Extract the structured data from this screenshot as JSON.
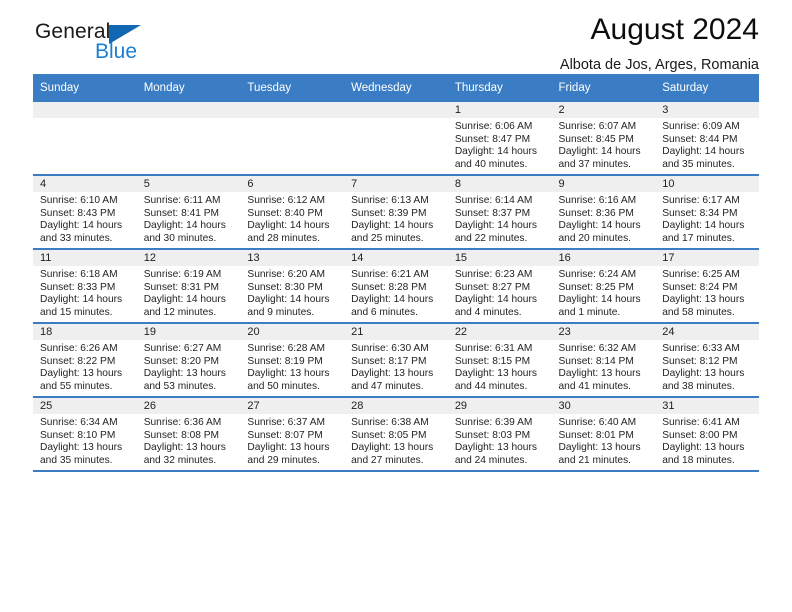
{
  "brand": {
    "name_part1": "General",
    "name_part2": "Blue",
    "logo_icon": "triangle-logo-icon"
  },
  "header": {
    "month_title": "August 2024",
    "location": "Albota de Jos, Arges, Romania"
  },
  "calendar": {
    "weekday_headers": [
      "Sunday",
      "Monday",
      "Tuesday",
      "Wednesday",
      "Thursday",
      "Friday",
      "Saturday"
    ],
    "accent_color": "#3b7dc4",
    "daynum_band_color": "#efefef",
    "weeks": [
      [
        {
          "day": "",
          "empty": true
        },
        {
          "day": "",
          "empty": true
        },
        {
          "day": "",
          "empty": true
        },
        {
          "day": "",
          "empty": true
        },
        {
          "day": "1",
          "sunrise": "Sunrise: 6:06 AM",
          "sunset": "Sunset: 8:47 PM",
          "daylight": "Daylight: 14 hours and 40 minutes."
        },
        {
          "day": "2",
          "sunrise": "Sunrise: 6:07 AM",
          "sunset": "Sunset: 8:45 PM",
          "daylight": "Daylight: 14 hours and 37 minutes."
        },
        {
          "day": "3",
          "sunrise": "Sunrise: 6:09 AM",
          "sunset": "Sunset: 8:44 PM",
          "daylight": "Daylight: 14 hours and 35 minutes."
        }
      ],
      [
        {
          "day": "4",
          "sunrise": "Sunrise: 6:10 AM",
          "sunset": "Sunset: 8:43 PM",
          "daylight": "Daylight: 14 hours and 33 minutes."
        },
        {
          "day": "5",
          "sunrise": "Sunrise: 6:11 AM",
          "sunset": "Sunset: 8:41 PM",
          "daylight": "Daylight: 14 hours and 30 minutes."
        },
        {
          "day": "6",
          "sunrise": "Sunrise: 6:12 AM",
          "sunset": "Sunset: 8:40 PM",
          "daylight": "Daylight: 14 hours and 28 minutes."
        },
        {
          "day": "7",
          "sunrise": "Sunrise: 6:13 AM",
          "sunset": "Sunset: 8:39 PM",
          "daylight": "Daylight: 14 hours and 25 minutes."
        },
        {
          "day": "8",
          "sunrise": "Sunrise: 6:14 AM",
          "sunset": "Sunset: 8:37 PM",
          "daylight": "Daylight: 14 hours and 22 minutes."
        },
        {
          "day": "9",
          "sunrise": "Sunrise: 6:16 AM",
          "sunset": "Sunset: 8:36 PM",
          "daylight": "Daylight: 14 hours and 20 minutes."
        },
        {
          "day": "10",
          "sunrise": "Sunrise: 6:17 AM",
          "sunset": "Sunset: 8:34 PM",
          "daylight": "Daylight: 14 hours and 17 minutes."
        }
      ],
      [
        {
          "day": "11",
          "sunrise": "Sunrise: 6:18 AM",
          "sunset": "Sunset: 8:33 PM",
          "daylight": "Daylight: 14 hours and 15 minutes."
        },
        {
          "day": "12",
          "sunrise": "Sunrise: 6:19 AM",
          "sunset": "Sunset: 8:31 PM",
          "daylight": "Daylight: 14 hours and 12 minutes."
        },
        {
          "day": "13",
          "sunrise": "Sunrise: 6:20 AM",
          "sunset": "Sunset: 8:30 PM",
          "daylight": "Daylight: 14 hours and 9 minutes."
        },
        {
          "day": "14",
          "sunrise": "Sunrise: 6:21 AM",
          "sunset": "Sunset: 8:28 PM",
          "daylight": "Daylight: 14 hours and 6 minutes."
        },
        {
          "day": "15",
          "sunrise": "Sunrise: 6:23 AM",
          "sunset": "Sunset: 8:27 PM",
          "daylight": "Daylight: 14 hours and 4 minutes."
        },
        {
          "day": "16",
          "sunrise": "Sunrise: 6:24 AM",
          "sunset": "Sunset: 8:25 PM",
          "daylight": "Daylight: 14 hours and 1 minute."
        },
        {
          "day": "17",
          "sunrise": "Sunrise: 6:25 AM",
          "sunset": "Sunset: 8:24 PM",
          "daylight": "Daylight: 13 hours and 58 minutes."
        }
      ],
      [
        {
          "day": "18",
          "sunrise": "Sunrise: 6:26 AM",
          "sunset": "Sunset: 8:22 PM",
          "daylight": "Daylight: 13 hours and 55 minutes."
        },
        {
          "day": "19",
          "sunrise": "Sunrise: 6:27 AM",
          "sunset": "Sunset: 8:20 PM",
          "daylight": "Daylight: 13 hours and 53 minutes."
        },
        {
          "day": "20",
          "sunrise": "Sunrise: 6:28 AM",
          "sunset": "Sunset: 8:19 PM",
          "daylight": "Daylight: 13 hours and 50 minutes."
        },
        {
          "day": "21",
          "sunrise": "Sunrise: 6:30 AM",
          "sunset": "Sunset: 8:17 PM",
          "daylight": "Daylight: 13 hours and 47 minutes."
        },
        {
          "day": "22",
          "sunrise": "Sunrise: 6:31 AM",
          "sunset": "Sunset: 8:15 PM",
          "daylight": "Daylight: 13 hours and 44 minutes."
        },
        {
          "day": "23",
          "sunrise": "Sunrise: 6:32 AM",
          "sunset": "Sunset: 8:14 PM",
          "daylight": "Daylight: 13 hours and 41 minutes."
        },
        {
          "day": "24",
          "sunrise": "Sunrise: 6:33 AM",
          "sunset": "Sunset: 8:12 PM",
          "daylight": "Daylight: 13 hours and 38 minutes."
        }
      ],
      [
        {
          "day": "25",
          "sunrise": "Sunrise: 6:34 AM",
          "sunset": "Sunset: 8:10 PM",
          "daylight": "Daylight: 13 hours and 35 minutes."
        },
        {
          "day": "26",
          "sunrise": "Sunrise: 6:36 AM",
          "sunset": "Sunset: 8:08 PM",
          "daylight": "Daylight: 13 hours and 32 minutes."
        },
        {
          "day": "27",
          "sunrise": "Sunrise: 6:37 AM",
          "sunset": "Sunset: 8:07 PM",
          "daylight": "Daylight: 13 hours and 29 minutes."
        },
        {
          "day": "28",
          "sunrise": "Sunrise: 6:38 AM",
          "sunset": "Sunset: 8:05 PM",
          "daylight": "Daylight: 13 hours and 27 minutes."
        },
        {
          "day": "29",
          "sunrise": "Sunrise: 6:39 AM",
          "sunset": "Sunset: 8:03 PM",
          "daylight": "Daylight: 13 hours and 24 minutes."
        },
        {
          "day": "30",
          "sunrise": "Sunrise: 6:40 AM",
          "sunset": "Sunset: 8:01 PM",
          "daylight": "Daylight: 13 hours and 21 minutes."
        },
        {
          "day": "31",
          "sunrise": "Sunrise: 6:41 AM",
          "sunset": "Sunset: 8:00 PM",
          "daylight": "Daylight: 13 hours and 18 minutes."
        }
      ]
    ]
  }
}
